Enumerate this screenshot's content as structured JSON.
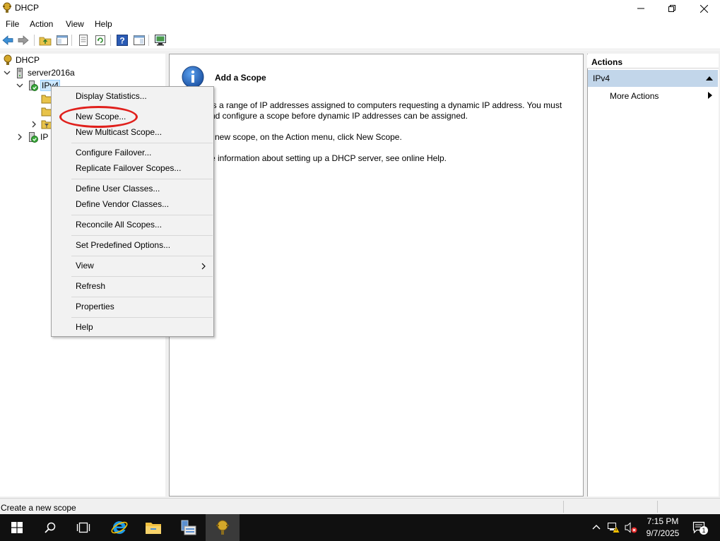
{
  "window": {
    "title": "DHCP"
  },
  "menu": [
    "File",
    "Action",
    "View",
    "Help"
  ],
  "tree": {
    "root": "DHCP",
    "server": "server2016a",
    "ipv4": "IPv4",
    "ipv6_partial": "IP"
  },
  "content": {
    "heading": "Add a Scope",
    "lines": [
      "is a range of IP addresses assigned to computers requesting a dynamic IP address. You must",
      "nd configure a scope before dynamic IP addresses can be assigned.",
      "new scope, on the Action menu, click New Scope.",
      "e information about setting up a DHCP server, see online Help."
    ]
  },
  "actions": {
    "header": "Actions",
    "section": "IPv4",
    "more": "More Actions"
  },
  "context_menu": {
    "items": [
      "Display Statistics...",
      "New Scope...",
      "New Multicast Scope...",
      "Configure Failover...",
      "Replicate Failover Scopes...",
      "Define User Classes...",
      "Define Vendor Classes...",
      "Reconcile All Scopes...",
      "Set Predefined Options...",
      "View",
      "Refresh",
      "Properties",
      "Help"
    ]
  },
  "status": {
    "text": "Create a new scope"
  },
  "tray": {
    "time": "7:15 PM",
    "date": "9/7/2025",
    "notification_count": "1"
  },
  "colors": {
    "accent": "#0078d7",
    "highlight": "#e0201c",
    "actions_section": "#c2d6ea"
  }
}
